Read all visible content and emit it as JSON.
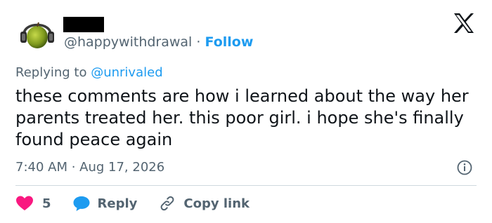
{
  "author": {
    "handle": "@happywithdrawal",
    "separator": "·",
    "follow_label": "Follow"
  },
  "reply_context": {
    "prefix": "Replying to",
    "mention": "@unrivaled"
  },
  "tweet": {
    "text": "these comments are how i learned about the way her parents treated her. this poor girl. i hope she's finally found peace again"
  },
  "meta": {
    "timestamp": "7:40 AM · Aug 17, 2026"
  },
  "actions": {
    "like_count": "5",
    "reply_label": "Reply",
    "copy_label": "Copy link"
  },
  "colors": {
    "accent": "#1d9bf0",
    "like": "#f91880",
    "muted": "#536471",
    "text": "#0f1419"
  },
  "icons": {
    "avatar": "apple-with-headphones",
    "logo": "x-logo-icon",
    "info": "info-icon",
    "like": "heart-icon",
    "reply": "speech-bubble-icon",
    "copy": "link-icon"
  }
}
